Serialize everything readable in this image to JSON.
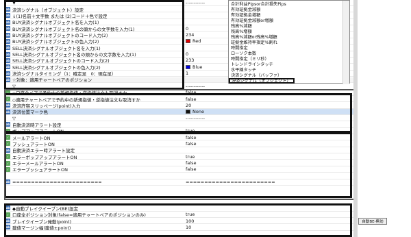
{
  "rows": [
    {
      "icon": "tri",
      "name": "▼",
      "value": "------------"
    },
    {
      "icon": "val",
      "name": "決済シグナル（オブジェクト）設定",
      "value": ""
    },
    {
      "icon": "val",
      "name": "↓(1)名前＋文字数 または (2)コード＋色で設定",
      "value": ""
    },
    {
      "icon": "val",
      "name": "BUY決済シグナルオブジェクト名を入力(1)",
      "value": ""
    },
    {
      "icon": "val",
      "name": "BUY決済シグナルオブジェクト名の頭からの文字数を入力(1)",
      "value": "0"
    },
    {
      "icon": "val",
      "name": "BUY決済シグナルオブジェクトのコード入力(2)",
      "value": "234"
    },
    {
      "icon": "val",
      "name": "BUY決済シグナルオブジェクトの色入力(2)",
      "value": "Red",
      "swatch": "#e00000"
    },
    {
      "icon": "val",
      "name": "SELL決済シグナルオブジェクト名を入力(1)",
      "value": ""
    },
    {
      "icon": "val",
      "name": "SELL決済シグナルオブジェクト名の頭からの文字数を入力(1)",
      "value": "0"
    },
    {
      "icon": "val",
      "name": "SELL決済シグナルオブジェクトのコード入力(2)",
      "value": "233"
    },
    {
      "icon": "val",
      "name": "SELL決済シグナルオブジェクトの色入力(2)",
      "value": "Blue",
      "swatch": "#0000e0"
    },
    {
      "icon": "val",
      "name": "決済シグナルタイミング（1：確定足　0：現在足）",
      "value": "1"
    },
    {
      "icon": "val",
      "name": "☆対象：適用チャートペアのポジション",
      "value": "",
      "group": true
    },
    {
      "icon": "tri",
      "name": "▽",
      "value": "------------"
    },
    {
      "icon": "bool",
      "name": "◇口座全ペアで予約中の新規指値・逆指値注文も取消すか",
      "value": "false"
    },
    {
      "icon": "bool",
      "name": "◇適用チャートペアで予約中の新規指値・逆指値注文も取消すか",
      "value": "false"
    },
    {
      "icon": "val",
      "name": "決済許容スリッページ(point)入力",
      "value": "20"
    },
    {
      "icon": "val",
      "name": "決済位置マーク色",
      "value": "None",
      "swatch": "#111111",
      "selected": true
    },
    {
      "icon": "tri",
      "name": "▽",
      "value": "------------"
    },
    {
      "icon": "val",
      "name": "自動決済時アラート設定",
      "value": ""
    },
    {
      "icon": "bool",
      "name": "ポップアップアラートON",
      "value": "true"
    },
    {
      "icon": "bool",
      "name": "メールアラートON",
      "value": "false"
    },
    {
      "icon": "bool",
      "name": "プッシュアラートON",
      "value": "false"
    },
    {
      "icon": "val",
      "name": "自動決済エラー時アラート設定",
      "value": ""
    },
    {
      "icon": "bool",
      "name": "エラーポップアップアラートON",
      "value": "true"
    },
    {
      "icon": "bool",
      "name": "エラーメールアラートON",
      "value": "false"
    },
    {
      "icon": "bool",
      "name": "エラープッシュアラートON",
      "value": "false"
    },
    {
      "icon": "tri",
      "name": "",
      "value": ""
    },
    {
      "icon": "val",
      "name": "========================",
      "value": "========================"
    },
    {
      "icon": "val",
      "name": "◆自動ブレイクイーブン(BE)設定",
      "value": ""
    },
    {
      "icon": "bool",
      "name": "口座全ポジション対象(false=適用チャートペアのポジションのみ)",
      "value": "true"
    },
    {
      "icon": "val",
      "name": "ブレイクイーブン発動(point)",
      "value": "100"
    },
    {
      "icon": "val",
      "name": "建値マージン幅(建値±point)",
      "value": "10"
    }
  ],
  "dropdown": {
    "items": [
      "合計利益Pipsor合計損失Pips",
      "有効証拠金減額",
      "有効証拠金増額",
      "有効証拠金減額or増額",
      "残高%減額",
      "残高%増額",
      "残高%減額or残高%増額",
      "証拠金維持率指定%割れ",
      "時間指定",
      "ローソク本数",
      "時間指定（ミリ秒）",
      "トレンドラインタッチ",
      "水平線タッチ",
      "決済シグナル（バッファ）",
      "決済シグナル（オブジェクト）"
    ],
    "selected_index": 14
  },
  "side_button": "自動BE-無効"
}
